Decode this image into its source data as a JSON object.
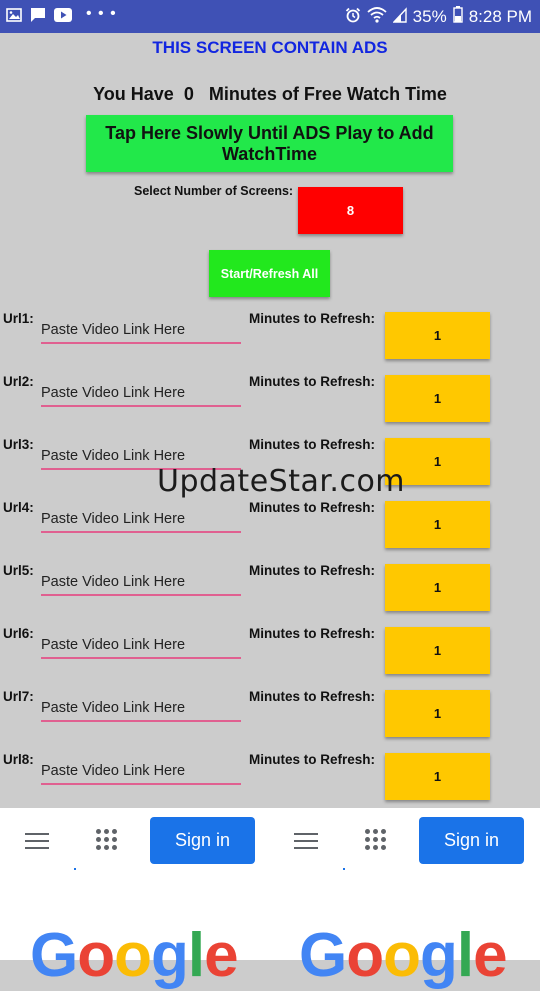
{
  "status_bar": {
    "icons_left": [
      "image-icon",
      "message-icon",
      "youtube-icon",
      "more-dots-icon"
    ],
    "icons_right": [
      "alarm-icon",
      "wifi-icon",
      "signal-icon",
      "battery-icon"
    ],
    "battery": "35%",
    "time": "8:28 PM"
  },
  "header": {
    "ads_notice": "THIS SCREEN CONTAIN ADS",
    "watch_time": "You Have  0   Minutes of Free Watch Time"
  },
  "tap_button": {
    "label": "Tap Here Slowly Until ADS Play to Add WatchTime"
  },
  "screens": {
    "label": "Select Number of Screens:",
    "value": "8"
  },
  "start_button": {
    "label": "Start/Refresh All"
  },
  "rows": [
    {
      "label": "Url1:",
      "placeholder": "Paste Video Link Here",
      "refresh_label": "Minutes to Refresh:",
      "refresh_value": "1"
    },
    {
      "label": "Url2:",
      "placeholder": "Paste Video Link Here",
      "refresh_label": "Minutes to Refresh:",
      "refresh_value": "1"
    },
    {
      "label": "Url3:",
      "placeholder": "Paste Video Link Here",
      "refresh_label": "Minutes to Refresh:",
      "refresh_value": "1"
    },
    {
      "label": "Url4:",
      "placeholder": "Paste Video Link Here",
      "refresh_label": "Minutes to Refresh:",
      "refresh_value": "1"
    },
    {
      "label": "Url5:",
      "placeholder": "Paste Video Link Here",
      "refresh_label": "Minutes to Refresh:",
      "refresh_value": "1"
    },
    {
      "label": "Url6:",
      "placeholder": "Paste Video Link Here",
      "refresh_label": "Minutes to Refresh:",
      "refresh_value": "1"
    },
    {
      "label": "Url7:",
      "placeholder": "Paste Video Link Here",
      "refresh_label": "Minutes to Refresh:",
      "refresh_value": "1"
    },
    {
      "label": "Url8:",
      "placeholder": "Paste Video Link Here",
      "refresh_label": "Minutes to Refresh:",
      "refresh_value": "1"
    }
  ],
  "watermark": "UpdateStar.com",
  "ad_banner": {
    "left": {
      "signin_label": "Sign in",
      "logo_text": "Google"
    },
    "right": {
      "signin_label": "Sign in",
      "logo_text": "Google"
    },
    "icons": [
      "menu-icon",
      "apps-grid-icon"
    ]
  },
  "colors": {
    "status_bar": "#3f51b5",
    "background": "#cccccc",
    "ads_notice": "#1226e0",
    "tap_button": "#22e84a",
    "screens_button": "#ff0000",
    "start_button": "#22e81d",
    "refresh_button": "#ffc800",
    "signin_button": "#1a73e8"
  }
}
